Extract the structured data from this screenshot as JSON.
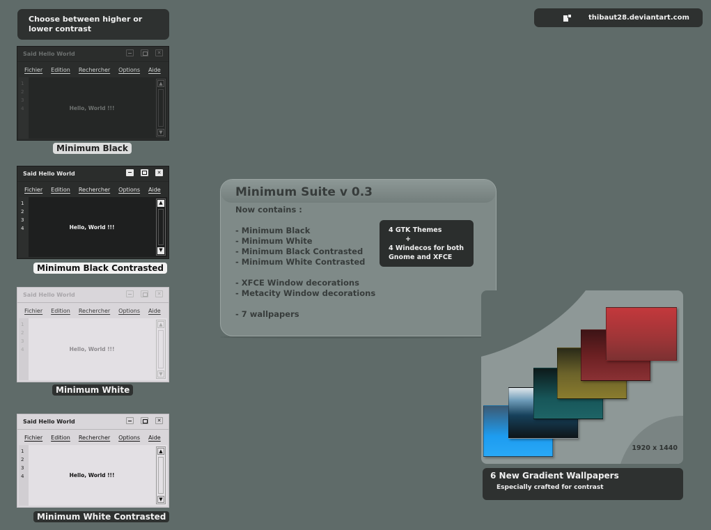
{
  "caption": "Choose between higher or lower contrast",
  "credit": {
    "text": "thibaut28.deviantart.com",
    "icon": "page-icon"
  },
  "editor": {
    "window_title": "Said Hello World",
    "menu": [
      "Fichier",
      "Edition",
      "Rechercher",
      "Options",
      "Aide"
    ],
    "line_numbers": [
      "1",
      "2",
      "3",
      "4"
    ],
    "content": "Hello, World !!!"
  },
  "themes": [
    {
      "label": "Minimum Black"
    },
    {
      "label": "Minimum Black Contrasted"
    },
    {
      "label": "Minimum White"
    },
    {
      "label": "Minimum White Contrasted"
    }
  ],
  "suite": {
    "title": "Minimum Suite v 0.3",
    "subtitle": "Now contains :",
    "items": [
      "- Minimum Black",
      "- Minimum White",
      "- Minimum Black Contrasted",
      "- Minimum White Contrasted",
      "",
      "- XFCE Window decorations",
      "- Metacity Window decorations",
      "",
      "- 7 wallpapers"
    ],
    "gtk_box": {
      "line1": "4 GTK Themes",
      "line2": "+",
      "line3": "4 Windecos for both",
      "line4": "Gnome and XFCE"
    }
  },
  "wallpapers": {
    "resolution": "1920 x 1440",
    "title": "6 New Gradient Wallpapers",
    "subtitle": "Especially crafted for contrast",
    "colors": [
      "#1d9cf0",
      "#0e1518",
      "#175659",
      "#7a6f28",
      "#6b2022",
      "#b23a3d"
    ]
  },
  "colors": {
    "background": "#5f6b69",
    "dark_panel": "#2e3130"
  }
}
